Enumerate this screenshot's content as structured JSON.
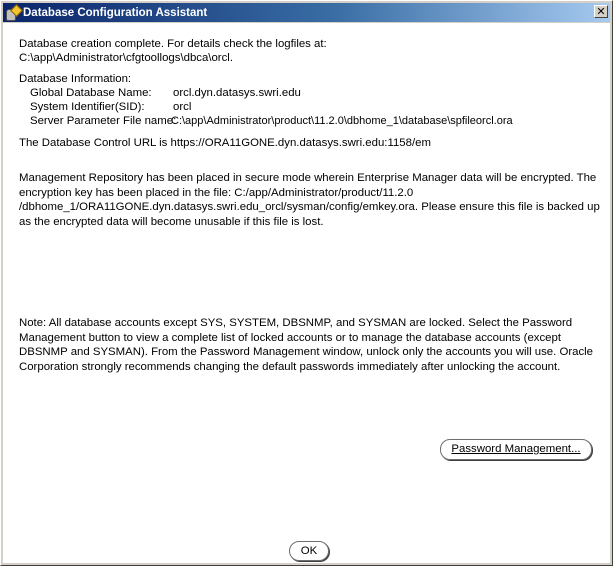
{
  "window": {
    "title": "Database Configuration Assistant",
    "close_glyph": "✕"
  },
  "intro": {
    "line1": "Database creation complete. For details check the logfiles at:",
    "line2": " C:\\app\\Administrator\\cfgtoollogs\\dbca\\orcl."
  },
  "db_info": {
    "heading": "Database Information:",
    "rows": [
      {
        "label": "Global Database Name:",
        "value": "orcl.dyn.datasys.swri.edu"
      },
      {
        "label": "System Identifier(SID):",
        "value": "orcl"
      },
      {
        "label": "Server Parameter File name:",
        "value": "C:\\app\\Administrator\\product\\11.2.0\\dbhome_1\\database\\spfileorcl.ora"
      }
    ]
  },
  "control_url": "The Database Control URL is https://ORA11GONE.dyn.datasys.swri.edu:1158/em",
  "repository_note": "Management Repository has been placed in secure mode wherein Enterprise Manager data will be encrypted.  The encryption key has been placed in the file: C:/app/Administrator/product/11.2.0 /dbhome_1/ORA11GONE.dyn.datasys.swri.edu_orcl/sysman/config/emkey.ora.   Please ensure this file is backed up as the encrypted data will become unusable if this file is lost.",
  "accounts_note": "Note: All database accounts except SYS, SYSTEM, DBSNMP, and SYSMAN are locked. Select the Password Management button to view a complete list of locked accounts or to manage the database accounts (except DBSNMP and SYSMAN). From the Password Management window, unlock only the accounts you will use. Oracle Corporation strongly recommends changing the default passwords immediately after unlocking the account.",
  "buttons": {
    "password_management": "Password Management...",
    "ok": "OK"
  }
}
